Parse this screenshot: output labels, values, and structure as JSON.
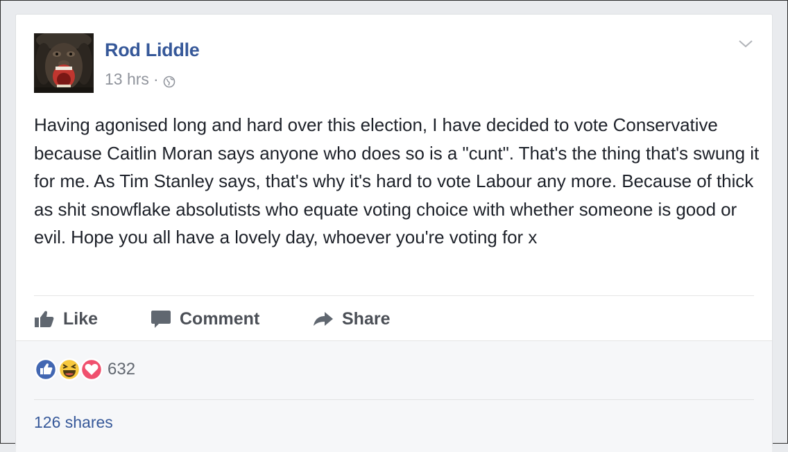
{
  "post": {
    "author": "Rod Liddle",
    "time": "13 hrs",
    "separator": "·",
    "privacy_icon": "globe-icon",
    "text": "Having agonised long and hard over this election, I have decided to vote Conservative because Caitlin Moran says anyone who does so is a \"cunt\". That's the thing that's swung it for me. As Tim Stanley says, that's why it's hard to vote Labour any more. Because of thick as shit snowflake absolutists who equate voting choice with whether someone is good or evil. Hope you all have a lovely day, whoever you're voting for x"
  },
  "actions": {
    "like_label": "Like",
    "comment_label": "Comment",
    "share_label": "Share"
  },
  "reactions": {
    "types": [
      "like",
      "haha",
      "love"
    ],
    "count": "632"
  },
  "shares": {
    "label": "126 shares"
  },
  "colors": {
    "name_link": "#365899",
    "meta_gray": "#90949c",
    "body_text": "#1d2129",
    "action_text": "#4b4f56",
    "like_blue": "#4267b2",
    "haha_yellow": "#f7c83e",
    "love_red": "#f0506e"
  }
}
